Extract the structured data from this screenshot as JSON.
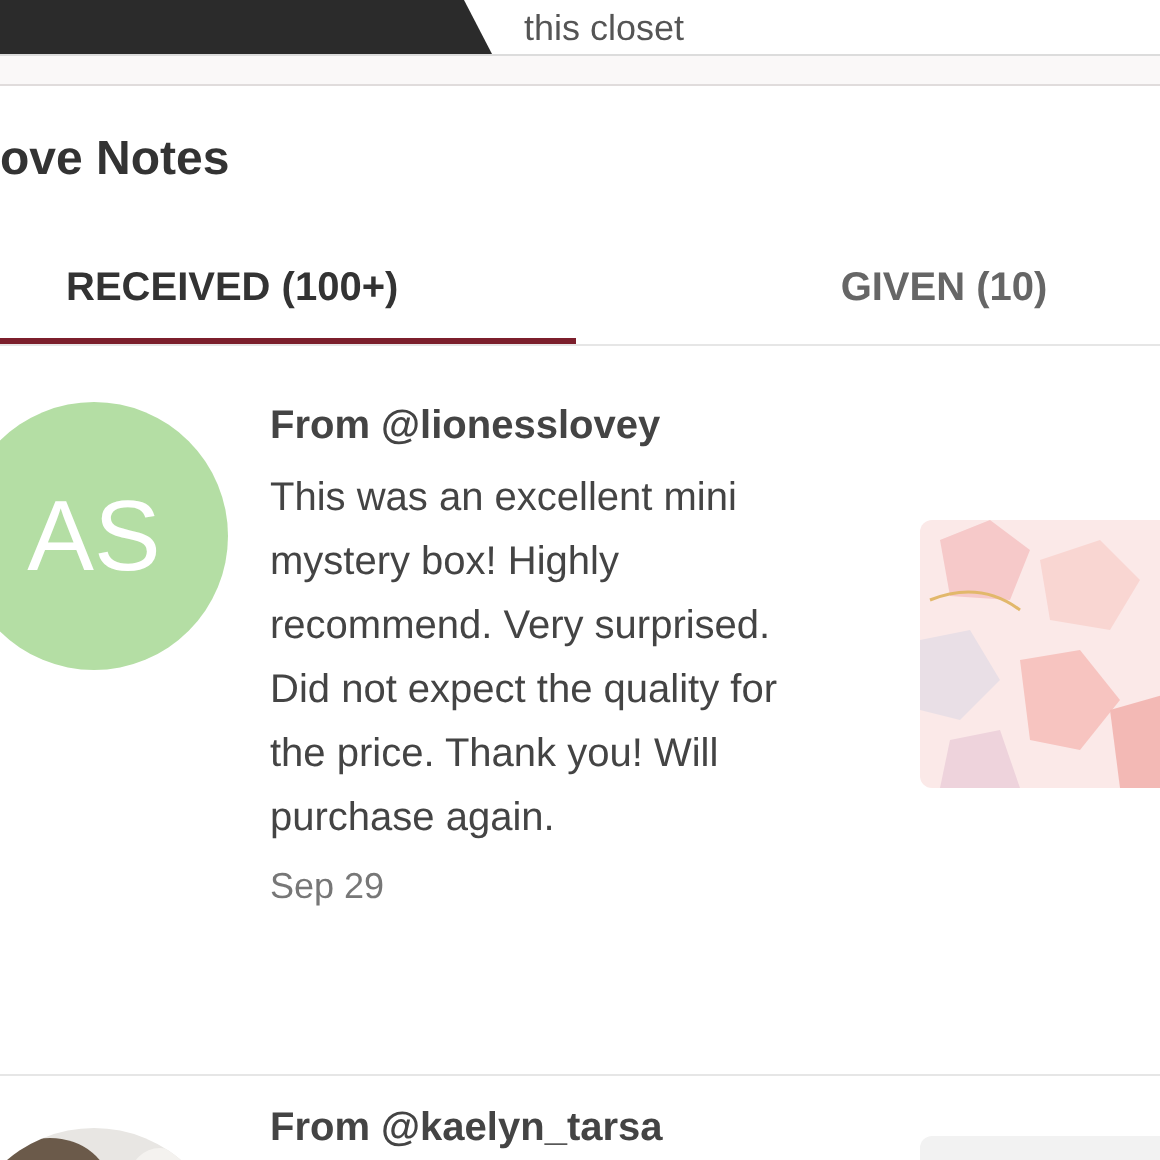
{
  "header": {
    "closet_text": "this closet"
  },
  "title": "ove Notes",
  "tabs": [
    {
      "label": "RECEIVED (100+)",
      "selected": true
    },
    {
      "label": "GIVEN (10)",
      "selected": false
    }
  ],
  "notes": [
    {
      "avatar": {
        "kind": "initials",
        "initials": "AS",
        "color": "#b4dea4"
      },
      "from": "From @lionesslovey",
      "text": "This was an excellent mini mystery box! Highly recommend. Very surprised. Did not expect the quality for the price. Thank you! Will purchase again.",
      "date": "Sep 29"
    },
    {
      "from": "From @kaelyn_tarsa",
      "thumbnail": {
        "kind": "blank"
      }
    }
  ]
}
